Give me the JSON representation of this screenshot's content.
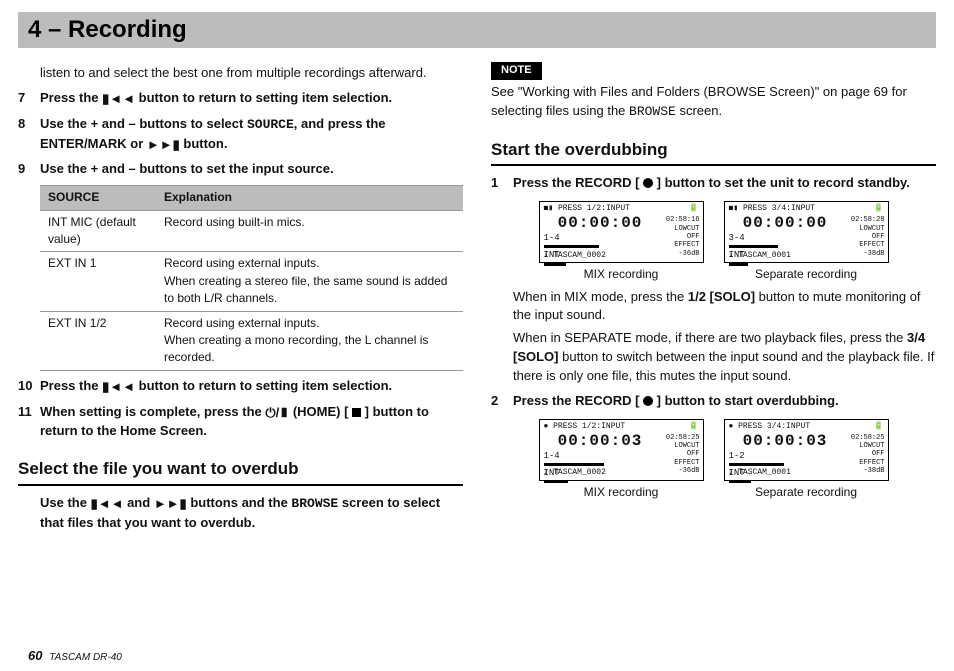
{
  "header": {
    "chapter": "4 – Recording"
  },
  "left": {
    "intro": "listen to and select the best one from multiple recordings afterward.",
    "step7a": "Press the ",
    "step7b": " button to return to setting item selection.",
    "step8a": "Use the + and – buttons to select ",
    "step8src": "SOURCE",
    "step8b": ", and press the ENTER/MARK or ",
    "step8c": " button.",
    "step9": "Use the + and – buttons to set the input source.",
    "table": {
      "h1": "SOURCE",
      "h2": "Explanation",
      "rows": [
        {
          "s": "INT MIC (default value)",
          "e": "Record using built-in mics."
        },
        {
          "s": "EXT IN 1",
          "e": "Record using external inputs.\nWhen creating a stereo file, the same sound is added to both L/R channels."
        },
        {
          "s": "EXT IN 1/2",
          "e": "Record using external inputs.\nWhen creating a mono recording, the L channel is recorded."
        }
      ]
    },
    "step10a": "Press the ",
    "step10b": " button to return to setting item selection.",
    "step11a": "When setting is complete, press the ",
    "step11home": "(HOME) [ ",
    "step11b": " ] button to return to the Home Screen.",
    "h_select": "Select the file you want to overdub",
    "sel_a": "Use the ",
    "sel_b": " and ",
    "sel_c": " buttons and the ",
    "sel_browse": "BROWSE",
    "sel_d": " screen to select that files that you want to overdub."
  },
  "right": {
    "note": "NOTE",
    "note_txt_a": "See \"Working with Files and Folders (BROWSE Screen)\" on page 69 for selecting files using the ",
    "note_browse": "BROWSE",
    "note_txt_b": " screen.",
    "h_start": "Start the overdubbing",
    "s1a": "Press the RECORD [ ",
    "s1b": " ] button to set the unit to record standby.",
    "mix_txt": "When in MIX mode, press the ",
    "mix_btn": "1/2 [SOLO]",
    "mix_txt2": " button to mute monitoring of the input sound.",
    "sep_txt": "When in SEPARATE mode, if there are two playback files, press the ",
    "sep_btn": "3/4 [SOLO]",
    "sep_txt2": " button to switch between the input sound and the playback file. If there is only one file, this mutes the input sound.",
    "s2a": "Press the RECORD [ ",
    "s2b": " ] button to start overdubbing.",
    "captions": {
      "mix": "MIX recording",
      "sep": "Separate recording"
    },
    "screens": {
      "a1": {
        "top": "PRESS 1/2:INPUT",
        "time": "00:00:00",
        "rem": "02:58:16",
        "s1": "LOWCUT",
        "s2": "OFF",
        "s3": "EFFECT",
        "s4": "-36dB",
        "l1": "1-4",
        "l2": "INT",
        "bot": "♪ TASCAM_0002"
      },
      "a2": {
        "top": "PRESS 3/4:INPUT",
        "time": "00:00:00",
        "rem": "02:58:28",
        "s1": "LOWCUT",
        "s2": "OFF",
        "s3": "EFFECT",
        "s4": "-38dB",
        "l1": "3-4",
        "l2": "INT",
        "bot": "♪ TASCAM_0001"
      },
      "b1": {
        "top": "PRESS 1/2:INPUT",
        "time": "00:00:03",
        "rem": "02:58:25",
        "s1": "LOWCUT",
        "s2": "OFF",
        "s3": "EFFECT",
        "s4": "-36dB",
        "l1": "1-4",
        "l2": "INT",
        "bot": "♪ TASCAM_0002"
      },
      "b2": {
        "top": "PRESS 3/4:INPUT",
        "time": "00:00:03",
        "rem": "02:58:25",
        "s1": "LOWCUT",
        "s2": "OFF",
        "s3": "EFFECT",
        "s4": "-38dB",
        "l1": "1-2",
        "l2": "INT",
        "bot": "♪ TASCAM_0001"
      }
    }
  },
  "footer": {
    "page": "60",
    "model": "TASCAM DR-40"
  }
}
